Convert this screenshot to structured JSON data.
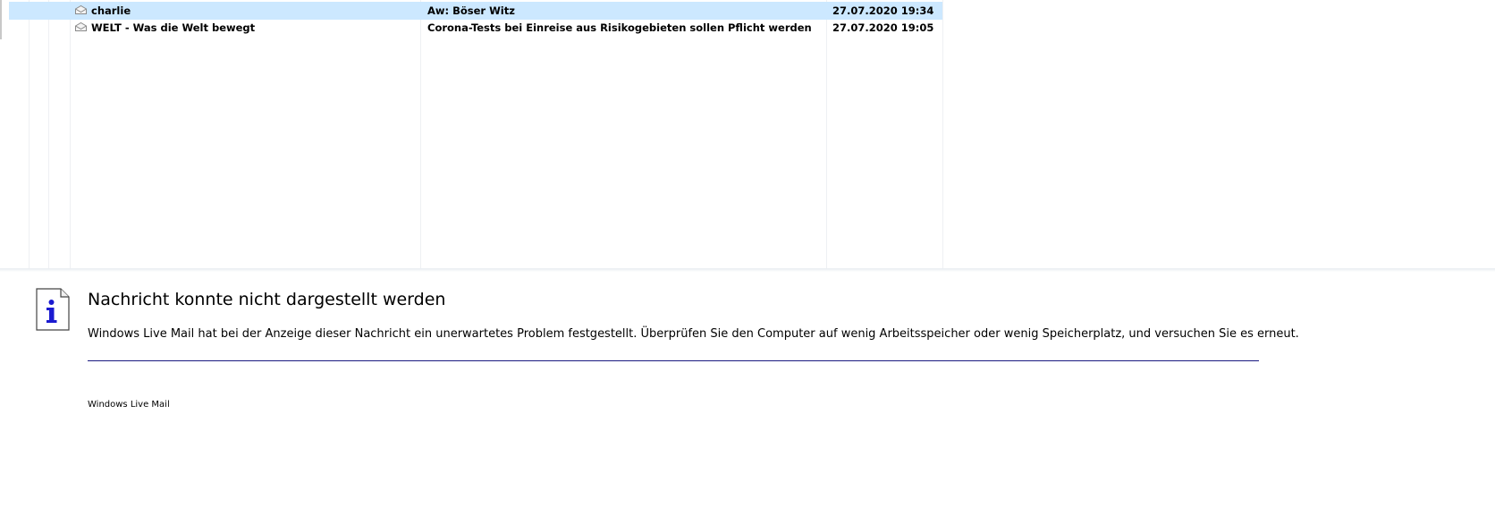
{
  "message_list": {
    "rows": [
      {
        "from": "charlie",
        "subject": "Aw: Böser Witz",
        "date": "27.07.2020 19:34",
        "selected": true
      },
      {
        "from": "WELT - Was die Welt bewegt",
        "subject": "Corona-Tests bei Einreise aus Risikogebieten sollen Pflicht werden",
        "date": "27.07.2020 19:05",
        "selected": false
      }
    ]
  },
  "preview": {
    "title": "Nachricht konnte nicht dargestellt werden",
    "message": "Windows Live Mail hat bei der Anzeige dieser Nachricht ein unerwartetes Problem festgestellt. Überprüfen Sie den Computer auf wenig Arbeitsspeicher oder wenig Speicherplatz, und versuchen Sie es erneut.",
    "footer": "Windows Live Mail",
    "icon": "info-document-icon"
  },
  "colors": {
    "selected_row": "#cce8ff",
    "rule": "#1a1a80",
    "icon_blue": "#1a1ad0"
  }
}
